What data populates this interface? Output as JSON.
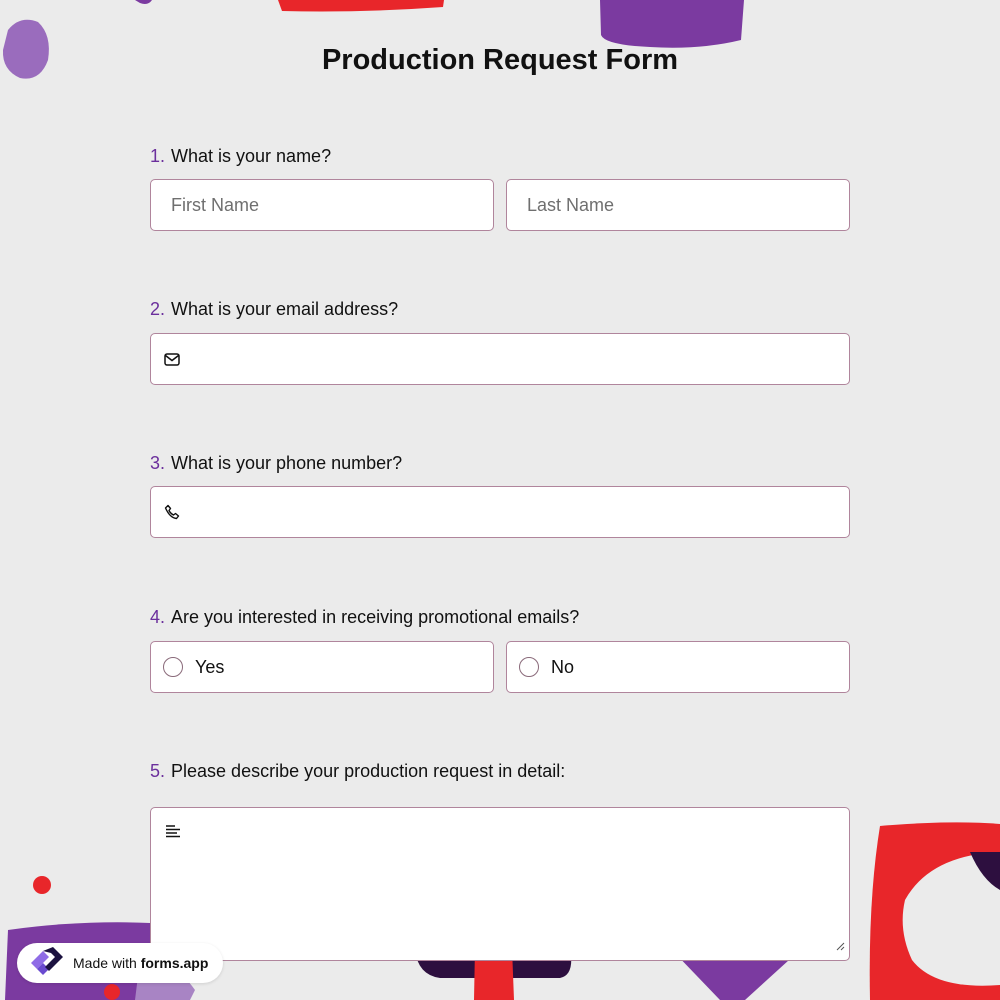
{
  "form": {
    "title": "Production Request Form"
  },
  "questions": [
    {
      "number": "1.",
      "text": "What is your name?"
    },
    {
      "number": "2.",
      "text": "What is your email address?"
    },
    {
      "number": "3.",
      "text": "What is your phone number?"
    },
    {
      "number": "4.",
      "text": "Are you interested in receiving promotional emails?"
    },
    {
      "number": "5.",
      "text": "Please describe your production request in detail:"
    }
  ],
  "name_fields": {
    "first_placeholder": "First Name",
    "last_placeholder": "Last Name"
  },
  "email_field": {
    "value": "",
    "icon": "envelope-icon"
  },
  "phone_field": {
    "value": "",
    "icon": "phone-icon"
  },
  "promo_options": [
    "Yes",
    "No"
  ],
  "detail_field": {
    "value": "",
    "icon": "text-align-left-icon"
  },
  "badge": {
    "prefix": "Made with",
    "brand": "forms.app"
  },
  "colors": {
    "background": "#ebebeb",
    "accent_purple": "#7b3aa0",
    "accent_red": "#e8262a",
    "dark_purple": "#2d0f3f",
    "field_border": "#b0859c"
  }
}
